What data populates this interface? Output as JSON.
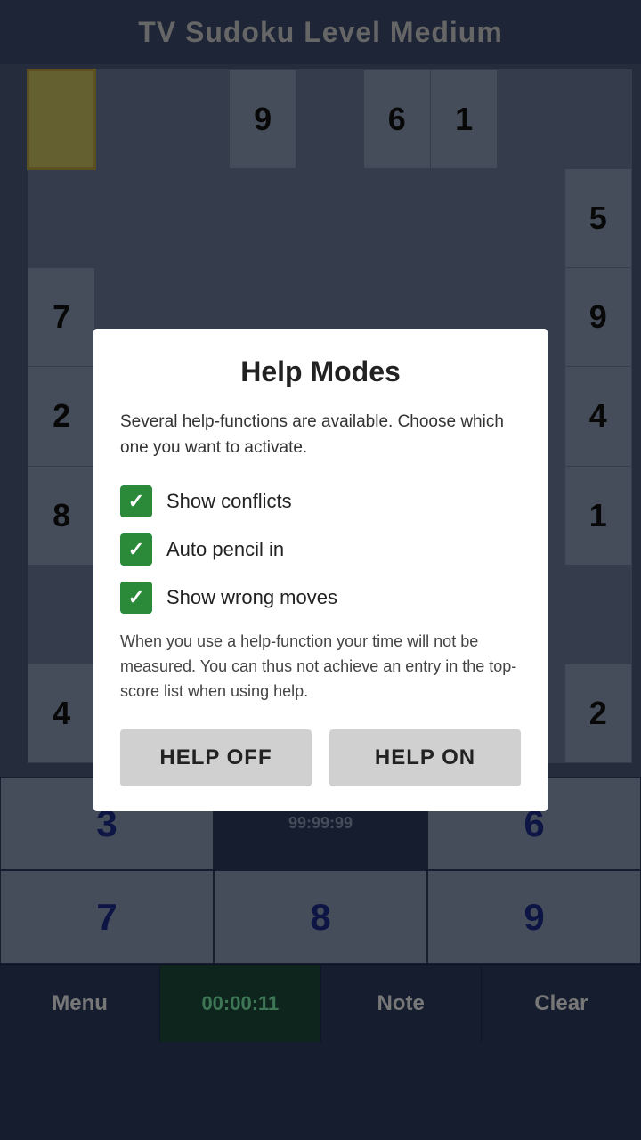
{
  "header": {
    "title": "TV Sudoku Level Medium"
  },
  "grid": {
    "cells": [
      [
        "",
        "",
        "",
        "9",
        "",
        "6",
        "1",
        "",
        ""
      ],
      [
        "",
        "",
        "",
        "",
        "",
        "",
        "",
        "",
        "5"
      ],
      [
        "7",
        "",
        "",
        "",
        "",
        "",
        "",
        "",
        "9"
      ],
      [
        "2",
        "",
        "",
        "",
        "",
        "",
        "",
        "",
        "4"
      ],
      [
        "8",
        "",
        "",
        "",
        "",
        "",
        "",
        "",
        "1"
      ],
      [
        "",
        "",
        "",
        "",
        "",
        "",
        "",
        "",
        ""
      ],
      [
        "4",
        "",
        "",
        "",
        "",
        "",
        "",
        "",
        "2"
      ]
    ]
  },
  "numpad": {
    "rows": [
      [
        "3",
        "6"
      ],
      [
        "9"
      ]
    ],
    "timer_label": "99:99:99"
  },
  "toolbar": {
    "menu_label": "Menu",
    "timer_label": "00:00:11",
    "note_label": "Note",
    "clear_label": "Clear"
  },
  "modal": {
    "title": "Help Modes",
    "description": "Several help-functions are available. Choose which one you want to activate.",
    "options": [
      {
        "id": "show-conflicts",
        "label": "Show conflicts",
        "checked": true
      },
      {
        "id": "auto-pencil",
        "label": "Auto pencil in",
        "checked": true
      },
      {
        "id": "show-wrong-moves",
        "label": "Show wrong moves",
        "checked": true
      }
    ],
    "warning": "When you use a help-function your time will not be measured. You can thus not achieve an entry in the top-score list when using help.",
    "btn_off": "HELP OFF",
    "btn_on": "HELP ON"
  }
}
